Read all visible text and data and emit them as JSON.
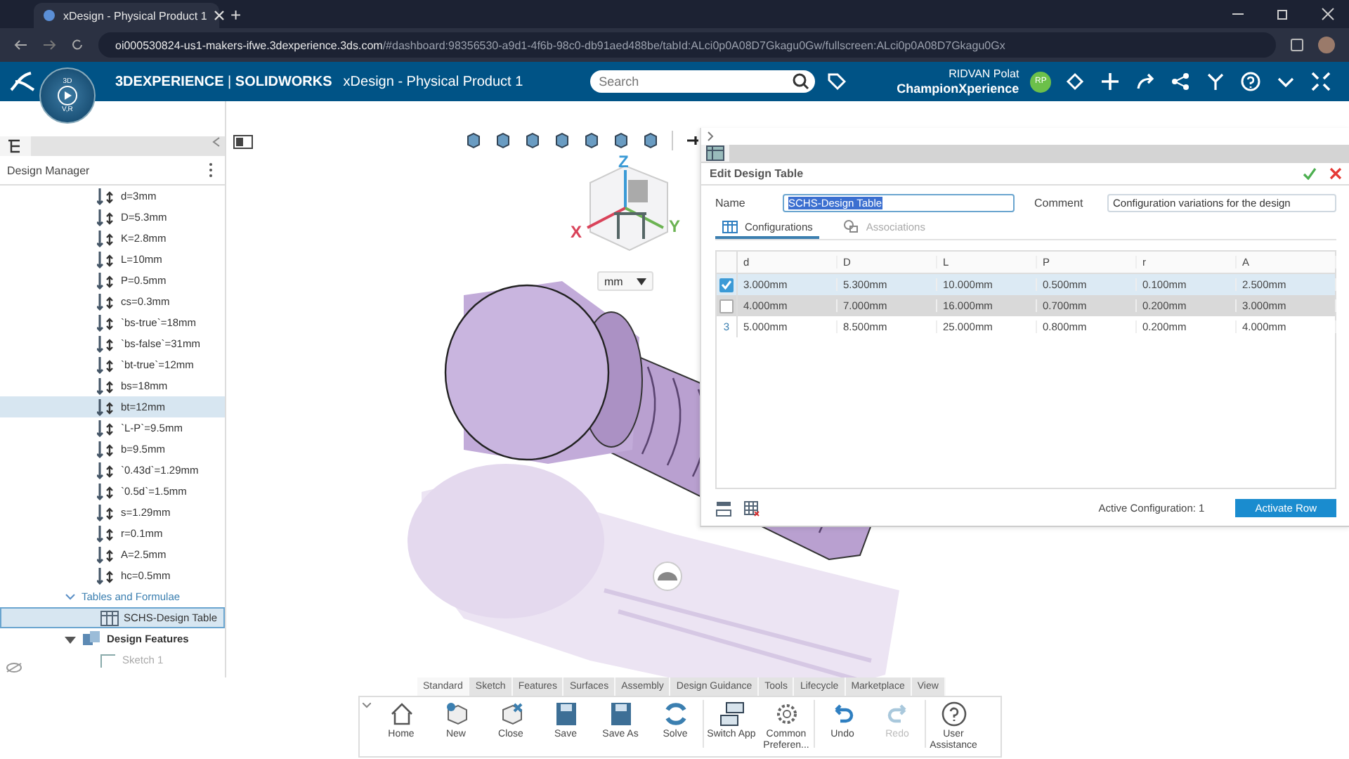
{
  "browser": {
    "tab_title": "xDesign - Physical Product 1",
    "new_tab": "+",
    "url_host": "oi000530824-us1-makers-ifwe.3dexperience.3ds.com",
    "url_path": "/#dashboard:98356530-a9d1-4f6b-98c0-db91aed488be/tabId:ALci0p0A08D7Gkagu0Gw/fullscreen:ALci0p0A08D7Gkagu0Gx"
  },
  "header": {
    "brand": "3DEXPERIENCE",
    "separator": "|",
    "product": "SOLIDWORKS",
    "app_title": "xDesign - Physical Product 1",
    "compass_labels": [
      "3D",
      "V,R"
    ],
    "search": {
      "placeholder": "Search"
    },
    "user_name": "RIDVAN Polat",
    "tenant": "ChampionXperience",
    "avatar": "RP"
  },
  "design_manager": {
    "title": "Design Manager",
    "tree": [
      {
        "label": "d=3mm",
        "kind": "parameter",
        "selected": false
      },
      {
        "label": "D=5.3mm",
        "kind": "parameter",
        "selected": false
      },
      {
        "label": "K=2.8mm",
        "kind": "parameter",
        "selected": false
      },
      {
        "label": "L=10mm",
        "kind": "parameter",
        "selected": false
      },
      {
        "label": "P=0.5mm",
        "kind": "parameter",
        "selected": false
      },
      {
        "label": "cs=0.3mm",
        "kind": "parameter",
        "selected": false
      },
      {
        "label": "`bs-true`=18mm",
        "kind": "parameter",
        "selected": false
      },
      {
        "label": "`bs-false`=31mm",
        "kind": "parameter",
        "selected": false
      },
      {
        "label": "`bt-true`=12mm",
        "kind": "parameter",
        "selected": false
      },
      {
        "label": "bs=18mm",
        "kind": "parameter",
        "selected": false
      },
      {
        "label": "bt=12mm",
        "kind": "parameter",
        "selected": true
      },
      {
        "label": "`L-P`=9.5mm",
        "kind": "parameter",
        "selected": false
      },
      {
        "label": "b=9.5mm",
        "kind": "parameter",
        "selected": false
      },
      {
        "label": "`0.43d`=1.29mm",
        "kind": "parameter",
        "selected": false
      },
      {
        "label": "`0.5d`=1.5mm",
        "kind": "parameter",
        "selected": false
      },
      {
        "label": "s=1.29mm",
        "kind": "parameter",
        "selected": false
      },
      {
        "label": "r=0.1mm",
        "kind": "parameter",
        "selected": false
      },
      {
        "label": "A=2.5mm",
        "kind": "parameter",
        "selected": false
      },
      {
        "label": "hc=0.5mm",
        "kind": "parameter",
        "selected": false
      },
      {
        "label": "Tables and Formulae",
        "kind": "folder",
        "expanded": true,
        "children": [
          {
            "label": "SCHS-Design Table",
            "kind": "table",
            "selected": true
          }
        ]
      },
      {
        "label": "Design Features",
        "kind": "features",
        "expanded": true,
        "children": [
          {
            "label": "Sketch 1",
            "kind": "sketch",
            "disabled": true
          }
        ]
      }
    ]
  },
  "viewport": {
    "units": "mm",
    "axes": [
      "X",
      "Y",
      "Z"
    ]
  },
  "edit_design_table": {
    "title": "Edit Design Table",
    "name_label": "Name",
    "name_value": "SCHS-Design Table",
    "comment_label": "Comment",
    "comment_value": "Configuration variations for the design",
    "tabs": [
      {
        "label": "Configurations",
        "selected": true
      },
      {
        "label": "Associations",
        "selected": false
      }
    ],
    "columns": [
      "d",
      "D",
      "L",
      "P",
      "r",
      "A"
    ],
    "rows": [
      {
        "kind": "checkbox",
        "checked": true,
        "selected": true,
        "hovered": false,
        "cells": [
          "3.000mm",
          "5.300mm",
          "10.000mm",
          "0.500mm",
          "0.100mm",
          "2.500mm"
        ]
      },
      {
        "kind": "checkbox",
        "checked": false,
        "selected": false,
        "hovered": true,
        "cells": [
          "4.000mm",
          "7.000mm",
          "16.000mm",
          "0.700mm",
          "0.200mm",
          "3.000mm"
        ]
      },
      {
        "kind": "number",
        "number": "3",
        "selected": false,
        "hovered": false,
        "cells": [
          "5.000mm",
          "8.500mm",
          "25.000mm",
          "0.800mm",
          "0.200mm",
          "4.000mm"
        ]
      }
    ],
    "active_configuration": "Active Configuration: 1",
    "activate_button": "Activate Row"
  },
  "ribbon": {
    "tabs": [
      {
        "label": "Standard",
        "selected": true
      },
      {
        "label": "Sketch",
        "selected": false
      },
      {
        "label": "Features",
        "selected": false
      },
      {
        "label": "Surfaces",
        "selected": false
      },
      {
        "label": "Assembly",
        "selected": false
      },
      {
        "label": "Design Guidance",
        "selected": false
      },
      {
        "label": "Tools",
        "selected": false
      },
      {
        "label": "Lifecycle",
        "selected": false
      },
      {
        "label": "Marketplace",
        "selected": false
      },
      {
        "label": "View",
        "selected": false
      }
    ],
    "buttons": [
      {
        "label": "Home",
        "kind": "home",
        "disabled": false
      },
      {
        "label": "New",
        "kind": "new",
        "disabled": false
      },
      {
        "label": "Close",
        "kind": "close",
        "disabled": false
      },
      {
        "label": "Save",
        "kind": "save",
        "disabled": false
      },
      {
        "label": "Save As",
        "kind": "saveas",
        "disabled": false
      },
      {
        "label": "Solve",
        "kind": "solve",
        "disabled": false
      },
      {
        "label": "Switch App",
        "kind": "switch",
        "disabled": false
      },
      {
        "label": "Common Preferen...",
        "kind": "prefs",
        "disabled": false
      },
      {
        "label": "Undo",
        "kind": "undo",
        "disabled": false
      },
      {
        "label": "Redo",
        "kind": "redo",
        "disabled": true
      },
      {
        "label": "User Assistance",
        "kind": "help",
        "disabled": false
      }
    ]
  }
}
